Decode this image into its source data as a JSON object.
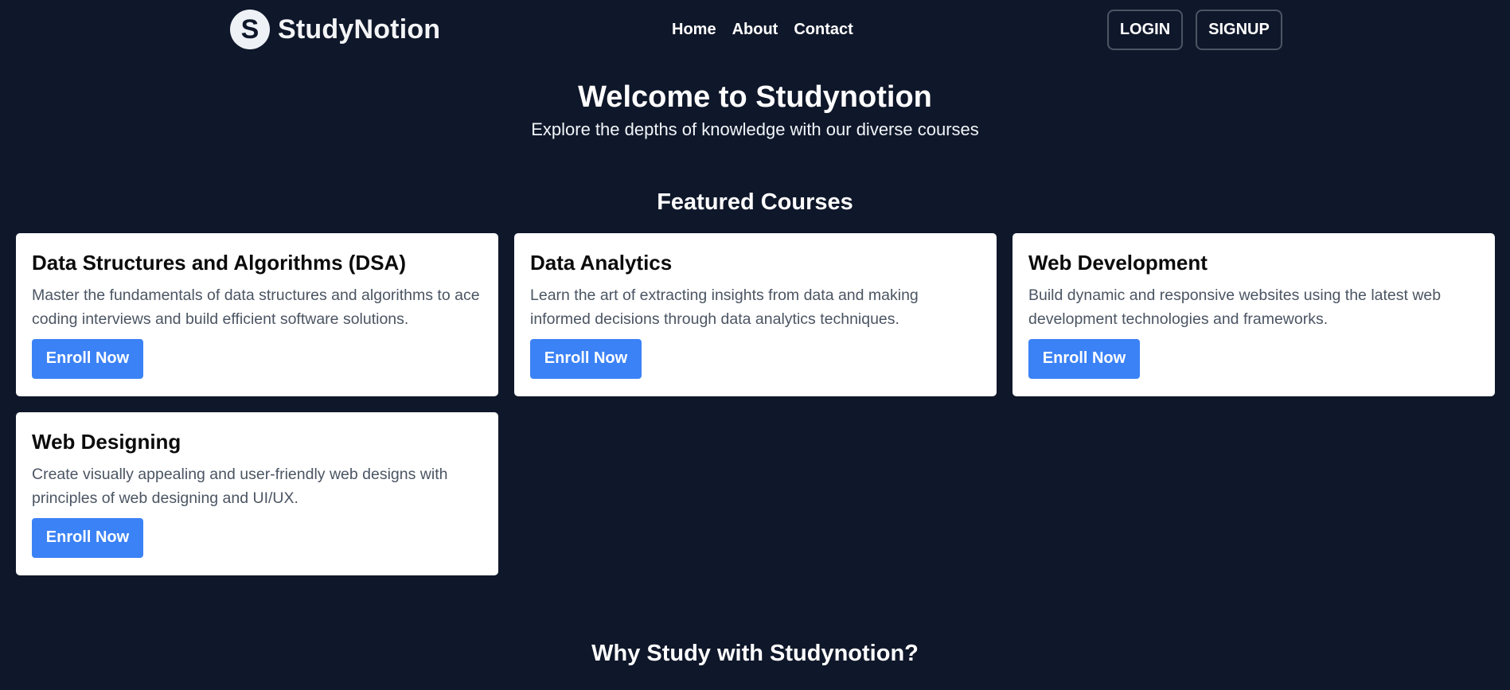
{
  "navbar": {
    "brand_letter": "S",
    "brand_name": "StudyNotion",
    "links": [
      "Home",
      "About",
      "Contact"
    ],
    "login_label": "LOGIN",
    "signup_label": "SIGNUP"
  },
  "hero": {
    "title": "Welcome to Studynotion",
    "subtitle": "Explore the depths of knowledge with our diverse courses"
  },
  "featured": {
    "title": "Featured Courses",
    "courses": [
      {
        "title": "Data Structures and Algorithms (DSA)",
        "description": "Master the fundamentals of data structures and algorithms to ace coding interviews and build efficient software solutions.",
        "button": "Enroll Now"
      },
      {
        "title": "Data Analytics",
        "description": "Learn the art of extracting insights from data and making informed decisions through data analytics techniques.",
        "button": "Enroll Now"
      },
      {
        "title": "Web Development",
        "description": "Build dynamic and responsive websites using the latest web development technologies and frameworks.",
        "button": "Enroll Now"
      },
      {
        "title": "Web Designing",
        "description": "Create visually appealing and user-friendly web designs with principles of web designing and UI/UX.",
        "button": "Enroll Now"
      }
    ]
  },
  "why": {
    "title": "Why Study with Studynotion?"
  },
  "colors": {
    "background": "#0f172a",
    "card": "#ffffff",
    "accent": "#3b82f6",
    "muted_text": "#4b5563"
  }
}
